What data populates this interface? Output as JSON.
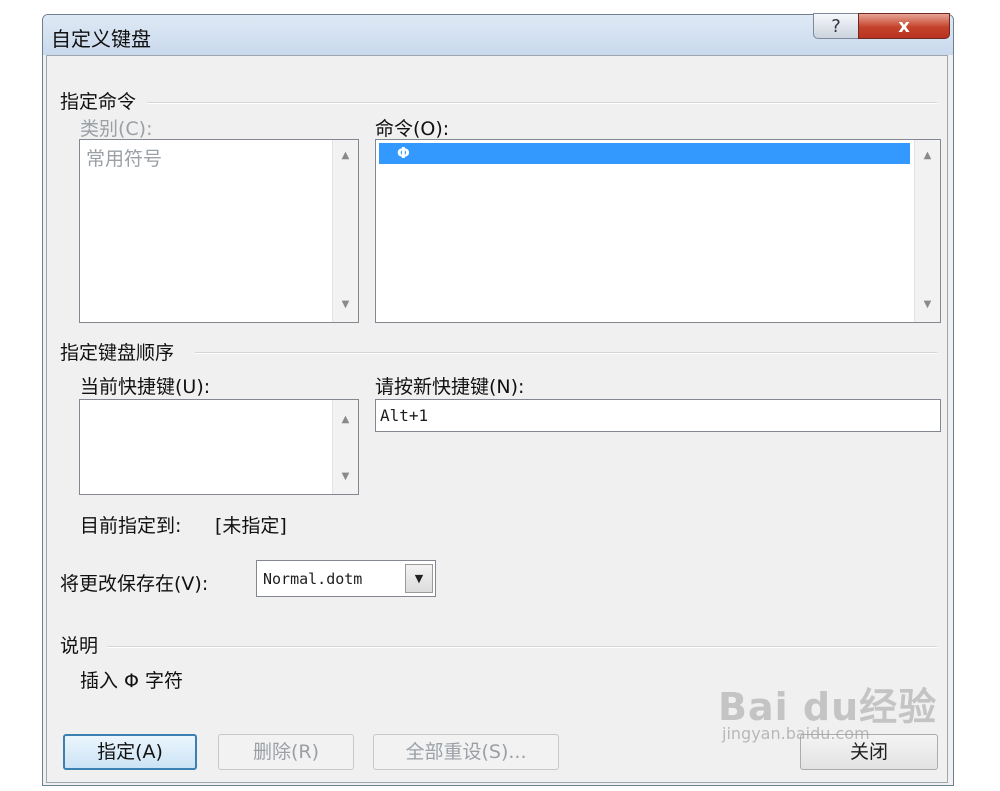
{
  "window": {
    "title": "自定义键盘",
    "help_glyph": "?",
    "close_glyph": "x"
  },
  "assign_command": {
    "section_label": "指定命令",
    "category_label": "类别(C):",
    "categories": [
      "常用符号"
    ],
    "command_label": "命令(O):",
    "commands": [
      "Φ"
    ]
  },
  "key_sequence": {
    "section_label": "指定键盘顺序",
    "current_keys_label": "当前快捷键(U):",
    "current_keys": [],
    "new_key_label": "请按新快捷键(N):",
    "new_key_value": "Alt+1",
    "currently_assigned_label": "目前指定到:",
    "currently_assigned_value": "[未指定]"
  },
  "save_in": {
    "label": "将更改保存在(V):",
    "selected": "Normal.dotm"
  },
  "description": {
    "section_label": "说明",
    "text": "插入 Φ 字符"
  },
  "buttons": {
    "assign": "指定(A)",
    "remove": "删除(R)",
    "reset_all": "全部重设(S)...",
    "close": "关闭"
  },
  "watermark": {
    "text": "Bai du经验",
    "sub": "jingyan.baidu.com"
  }
}
